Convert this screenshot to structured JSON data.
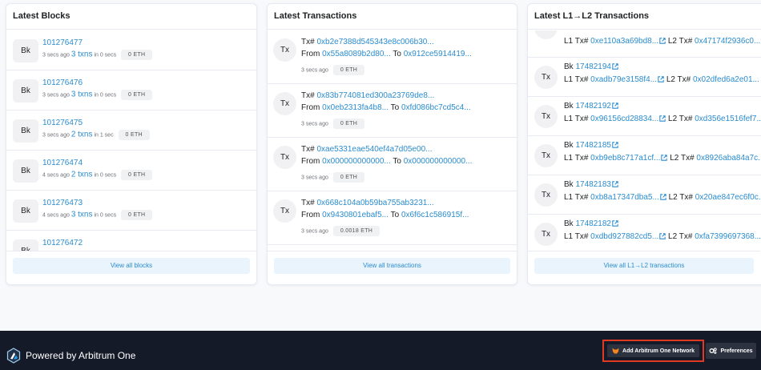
{
  "blocks": {
    "title": "Latest Blocks",
    "view_all": "View all blocks",
    "items": [
      {
        "avatar": "Bk",
        "number": "101276477",
        "age": "3 secs ago",
        "txns": "3 txns",
        "duration": "in 0 secs",
        "reward": "0 ETH"
      },
      {
        "avatar": "Bk",
        "number": "101276476",
        "age": "3 secs ago",
        "txns": "3 txns",
        "duration": "in 0 secs",
        "reward": "0 ETH"
      },
      {
        "avatar": "Bk",
        "number": "101276475",
        "age": "3 secs ago",
        "txns": "2 txns",
        "duration": "in 1 sec",
        "reward": "0 ETH"
      },
      {
        "avatar": "Bk",
        "number": "101276474",
        "age": "4 secs ago",
        "txns": "2 txns",
        "duration": "in 0 secs",
        "reward": "0 ETH"
      },
      {
        "avatar": "Bk",
        "number": "101276473",
        "age": "4 secs ago",
        "txns": "3 txns",
        "duration": "in 0 secs",
        "reward": "0 ETH"
      },
      {
        "avatar": "Bk",
        "number": "101276472",
        "age": "",
        "txns": "",
        "duration": "",
        "reward": ""
      }
    ]
  },
  "transactions": {
    "title": "Latest Transactions",
    "view_all": "View all transactions",
    "tx_prefix": "Tx#",
    "from_label": "From",
    "to_label": "To",
    "items": [
      {
        "avatar": "Tx",
        "hash": "0xb2e7388d545343e8c006b30...",
        "from": "0x55a8089b2d80...",
        "to": "0x912ce5914419...",
        "age": "3 secs ago",
        "value": "0 ETH"
      },
      {
        "avatar": "Tx",
        "hash": "0x83b774081ed300a23769de8...",
        "from": "0x0eb2313fa4b8...",
        "to": "0xfd086bc7cd5c4...",
        "age": "3 secs ago",
        "value": "0 ETH"
      },
      {
        "avatar": "Tx",
        "hash": "0xae5331eae540ef4a7d05e00...",
        "from": "0x000000000000...",
        "to": "0x000000000000...",
        "age": "3 secs ago",
        "value": "0 ETH"
      },
      {
        "avatar": "Tx",
        "hash": "0x668c104a0b59ba755ab3231...",
        "from": "0x9430801ebaf5...",
        "to": "0x6f6c1c586915f...",
        "age": "3 secs ago",
        "value": "0.0018 ETH"
      }
    ]
  },
  "l1l2": {
    "title": "Latest L1→L2 Transactions",
    "view_all": "View all L1→L2 transactions",
    "bk_label": "Bk",
    "l1_label": "L1 Tx#",
    "l2_label": "L2 Tx#",
    "partial": {
      "l1": "0xe110a3a69bd8...",
      "l2": "0x47174f2936c0..."
    },
    "items": [
      {
        "avatar": "Tx",
        "block": "17482194",
        "l1": "0xadb79e3158f4...",
        "l2": "0x02dfed6a2e01..."
      },
      {
        "avatar": "Tx",
        "block": "17482192",
        "l1": "0x96156cd28834...",
        "l2": "0xd356e1516fef7..."
      },
      {
        "avatar": "Tx",
        "block": "17482185",
        "l1": "0xb9eb8c717a1cf...",
        "l2": "0x8926aba84a7c..."
      },
      {
        "avatar": "Tx",
        "block": "17482183",
        "l1": "0xb8a17347dba5...",
        "l2": "0x20ae847ec6f0c..."
      },
      {
        "avatar": "Tx",
        "block": "17482182",
        "l1": "0xdbd927882cd5...",
        "l2": "0xfa7399697368..."
      }
    ]
  },
  "footer": {
    "brand": "Powered by Arbitrum One",
    "add_network": "Add Arbitrum One Network",
    "preferences": "Preferences"
  },
  "colors": {
    "link": "#2a8ccf",
    "footer_bg": "#151a28",
    "highlight": "#e13a23"
  }
}
